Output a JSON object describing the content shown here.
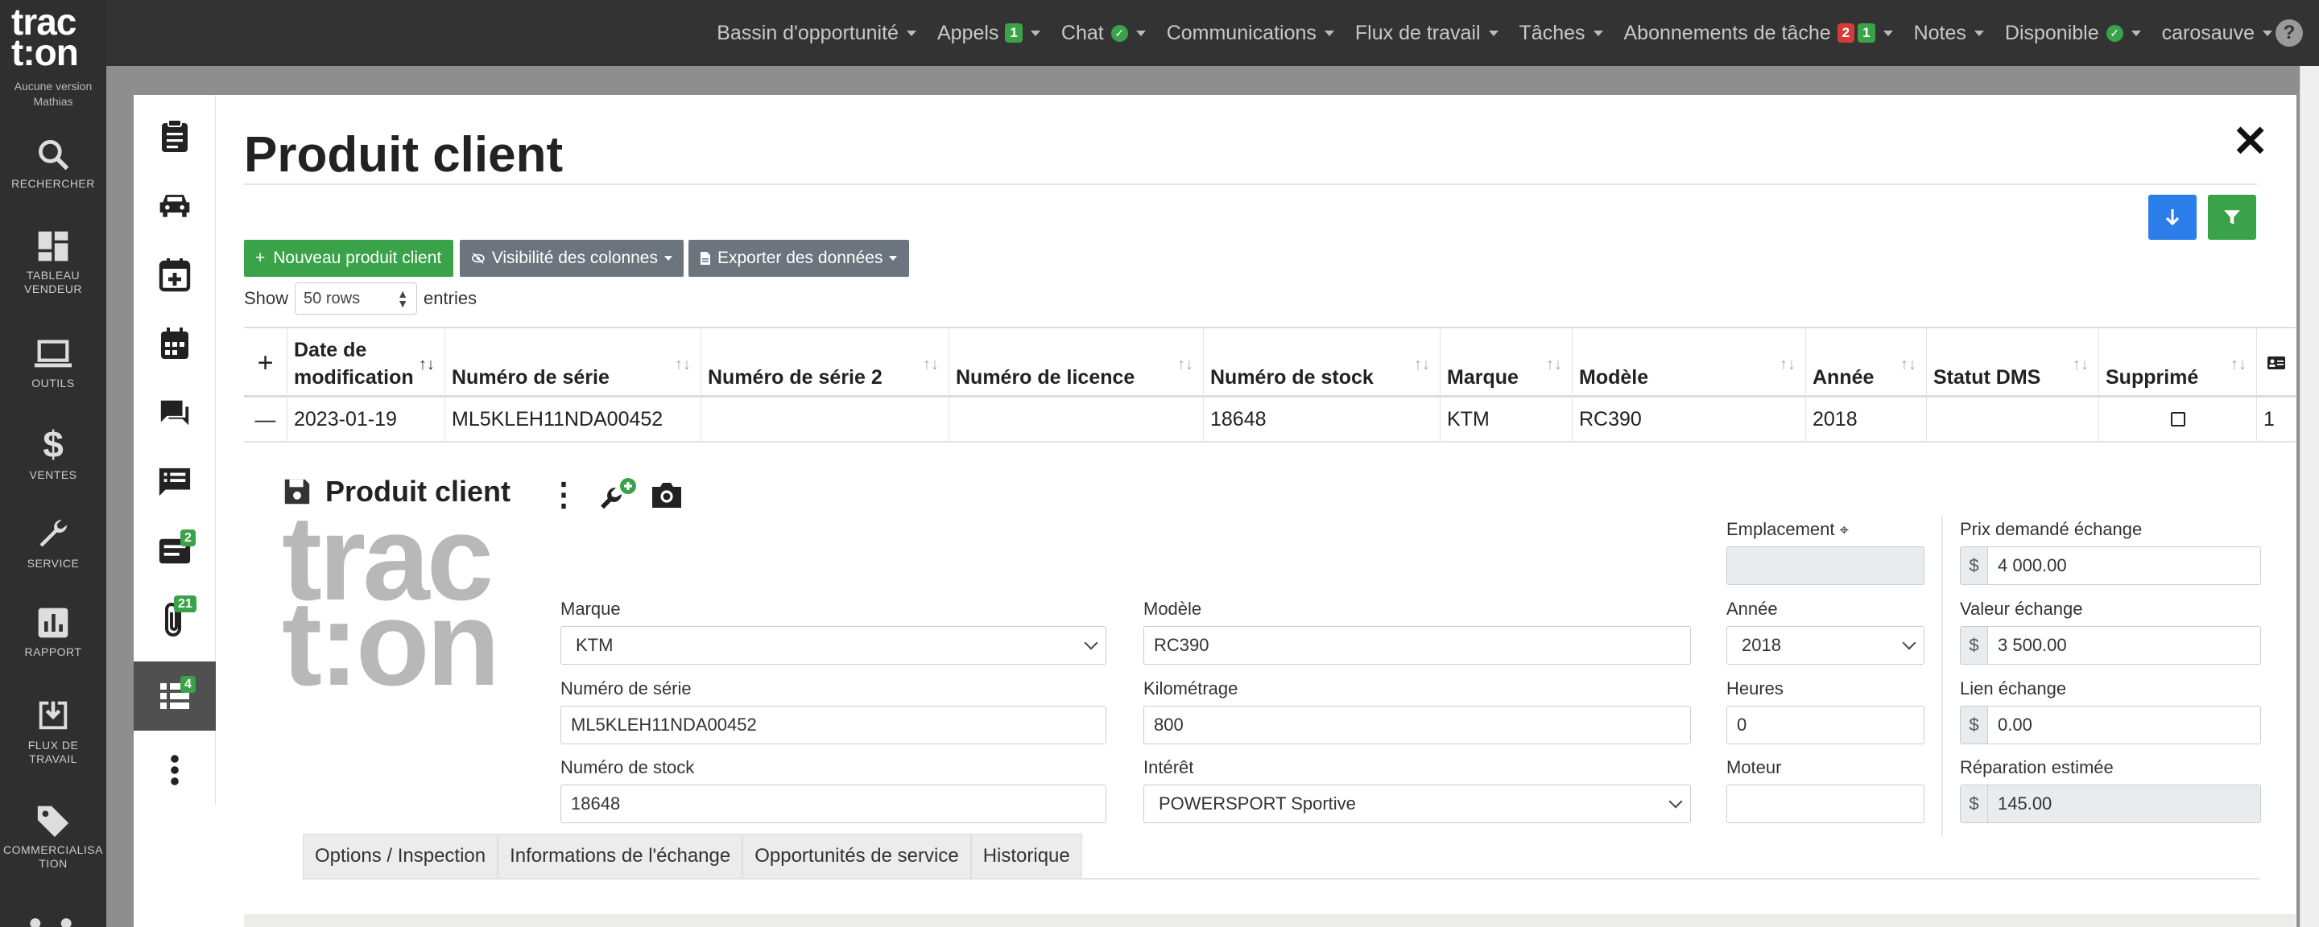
{
  "colors": {
    "green": "#3aa34a",
    "blue": "#2b7de9",
    "gray": "#6c757d",
    "dark": "#2f2f2f"
  },
  "logo": {
    "line1": "trac",
    "line2": "t:on",
    "sub1": "Aucune version",
    "sub2": "Mathias"
  },
  "nav": [
    {
      "label": "Bassin d'opportunité"
    },
    {
      "label": "Appels",
      "badge_green": "1"
    },
    {
      "label": "Chat",
      "ok": true
    },
    {
      "label": "Communications"
    },
    {
      "label": "Flux de travail"
    },
    {
      "label": "Tâches"
    },
    {
      "label": "Abonnements de tâche",
      "badge_red": "2",
      "badge_green": "1"
    },
    {
      "label": "Notes"
    },
    {
      "label": "Disponible",
      "ok": true
    },
    {
      "label": "carosauve"
    }
  ],
  "help_icon": "?",
  "sidebar": [
    {
      "label": "RECHERCHER",
      "icon": "search-icon"
    },
    {
      "label": "TABLEAU VENDEUR",
      "icon": "dashboard-icon"
    },
    {
      "label": "OUTILS",
      "icon": "laptop-icon"
    },
    {
      "label": "VENTES",
      "icon": "dollar-icon"
    },
    {
      "label": "SERVICE",
      "icon": "wrench-icon"
    },
    {
      "label": "RAPPORT",
      "icon": "chart-icon"
    },
    {
      "label": "FLUX DE TRAVAIL",
      "icon": "download-box-icon"
    },
    {
      "label": "COMMERCIALISATION",
      "icon": "tag-icon"
    }
  ],
  "sidebar_symbols": {
    "dollar": "$"
  },
  "rail": {
    "badge_notes": "2",
    "badge_attach": "21",
    "badge_list": "4"
  },
  "modal": {
    "title": "Produit client",
    "close": "✕",
    "btn_new": "Nouveau produit client",
    "btn_new_plus": "+",
    "btn_columns": "Visibilité des colonnes",
    "btn_export": "Exporter des données",
    "show_label": "Show",
    "show_value": "50 rows",
    "entries_label": "entries"
  },
  "table": {
    "headers": [
      "Date de modification",
      "Numéro de série",
      "Numéro de série 2",
      "Numéro de licence",
      "Numéro de stock",
      "Marque",
      "Modèle",
      "Année",
      "Statut DMS",
      "Supprimé"
    ],
    "expand_symbol": "+",
    "collapse_symbol": "—",
    "row": [
      "2023-01-19",
      "ML5KLEH11NDA00452",
      "",
      "",
      "18648",
      "KTM",
      "RC390",
      "2018",
      "",
      ""
    ],
    "row_last": "1"
  },
  "detail": {
    "title": "Produit client",
    "logo1": "trac",
    "logo2": "t:on",
    "more_symbol": "⋮",
    "labels": {
      "emplacement": "Emplacement",
      "marque": "Marque",
      "modele": "Modèle",
      "annee": "Année",
      "serie": "Numéro de série",
      "km": "Kilométrage",
      "heures": "Heures",
      "stock": "Numéro de stock",
      "interet": "Intérêt",
      "moteur": "Moteur",
      "prix": "Prix demandé échange",
      "valeur": "Valeur échange",
      "lien": "Lien échange",
      "reparation": "Réparation estimée"
    },
    "values": {
      "emplacement": "",
      "marque": "KTM",
      "modele": "RC390",
      "annee": "2018",
      "serie": "ML5KLEH11NDA00452",
      "km": "800",
      "heures": "0",
      "stock": "18648",
      "interet": "POWERSPORT Sportive",
      "moteur": "",
      "prix": "4 000.00",
      "valeur": "3 500.00",
      "lien": "0.00",
      "reparation": "145.00"
    },
    "currency": "$",
    "tabs": [
      "Options / Inspection",
      "Informations de l'échange",
      "Opportunités de service",
      "Historique"
    ]
  }
}
